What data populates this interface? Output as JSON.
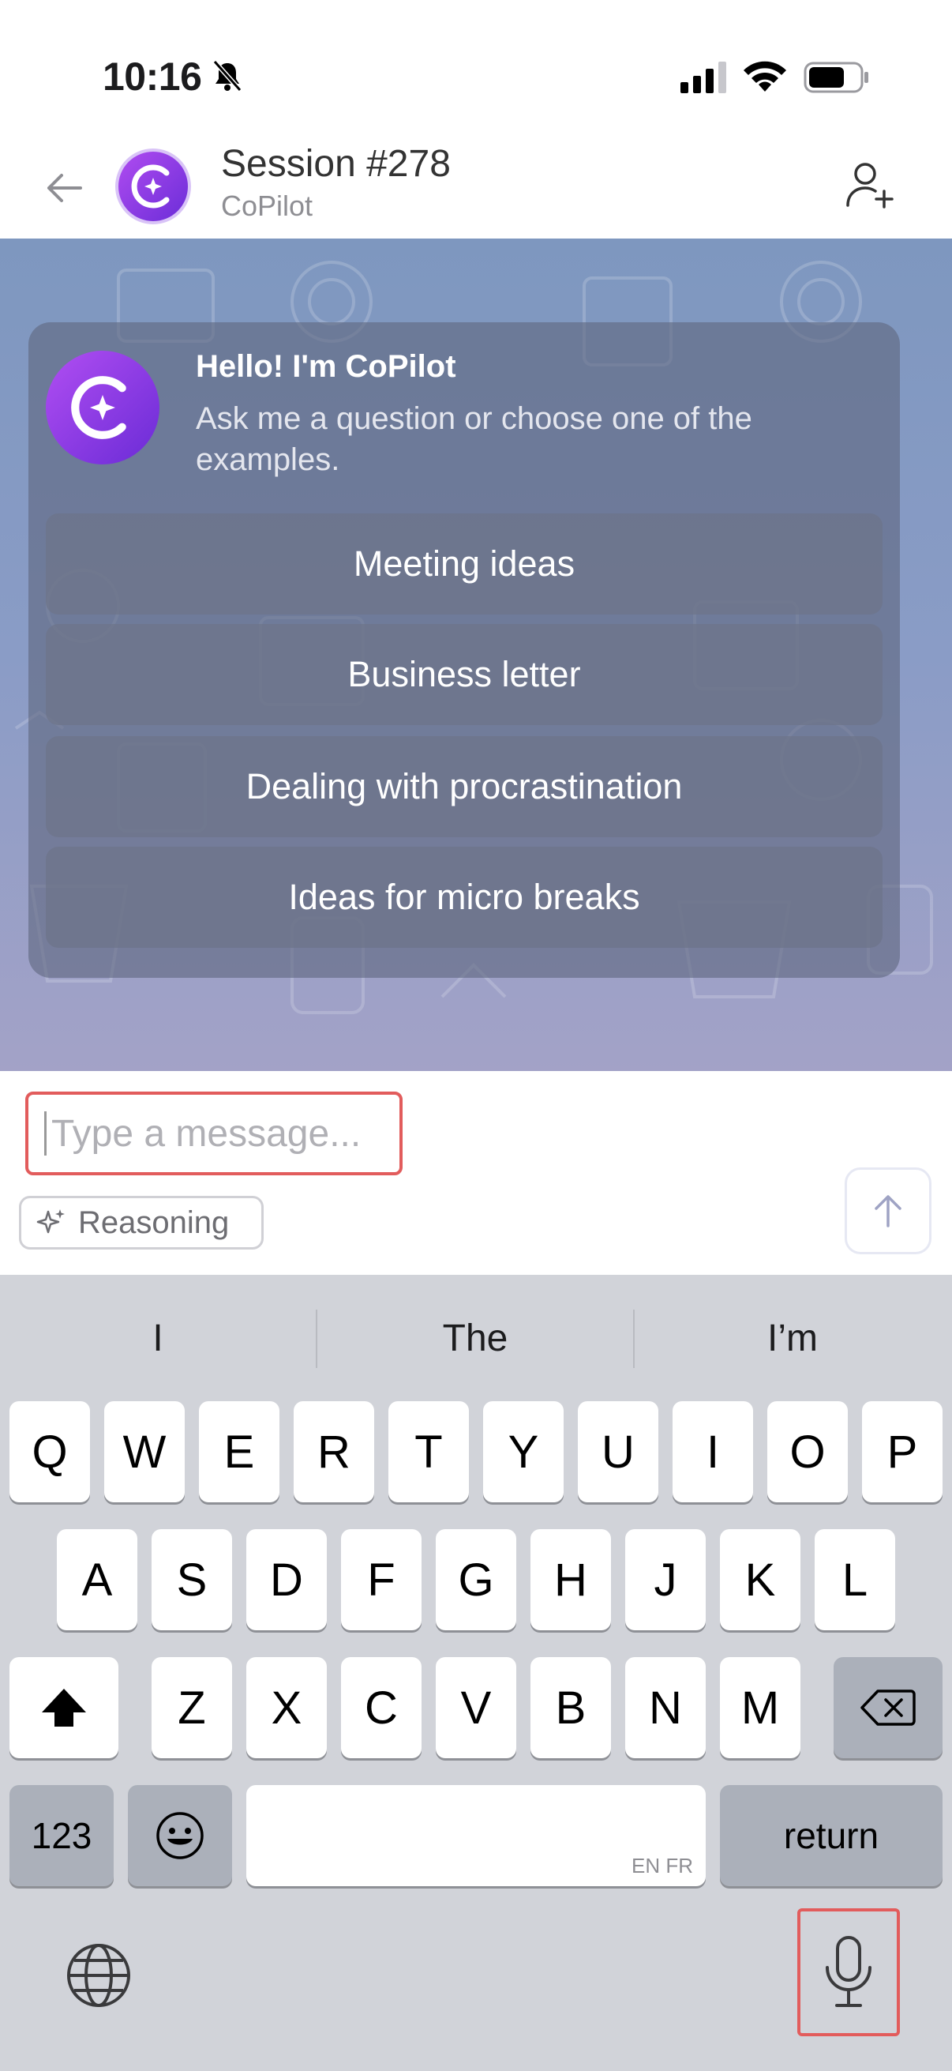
{
  "status_bar": {
    "time": "10:16"
  },
  "header": {
    "title": "Session #278",
    "subtitle": "CoPilot"
  },
  "intro": {
    "title": "Hello! I'm CoPilot",
    "text": "Ask me a question or choose one of the examples.",
    "examples": [
      "Meeting ideas",
      "Business letter",
      "Dealing with procrastination",
      "Ideas for micro breaks"
    ]
  },
  "composer": {
    "placeholder": "Type a message...",
    "reasoning_label": "Reasoning"
  },
  "keyboard": {
    "suggestions": [
      "I",
      "The",
      "I’m"
    ],
    "row1": [
      "Q",
      "W",
      "E",
      "R",
      "T",
      "Y",
      "U",
      "I",
      "O",
      "P"
    ],
    "row2": [
      "A",
      "S",
      "D",
      "F",
      "G",
      "H",
      "J",
      "K",
      "L"
    ],
    "row3": [
      "Z",
      "X",
      "C",
      "V",
      "B",
      "N",
      "M"
    ],
    "numbers_label": "123",
    "return_label": "return",
    "space_hint": "EN FR"
  },
  "colors": {
    "accent": "#8a3ee8",
    "highlight": "#e25c5c"
  }
}
